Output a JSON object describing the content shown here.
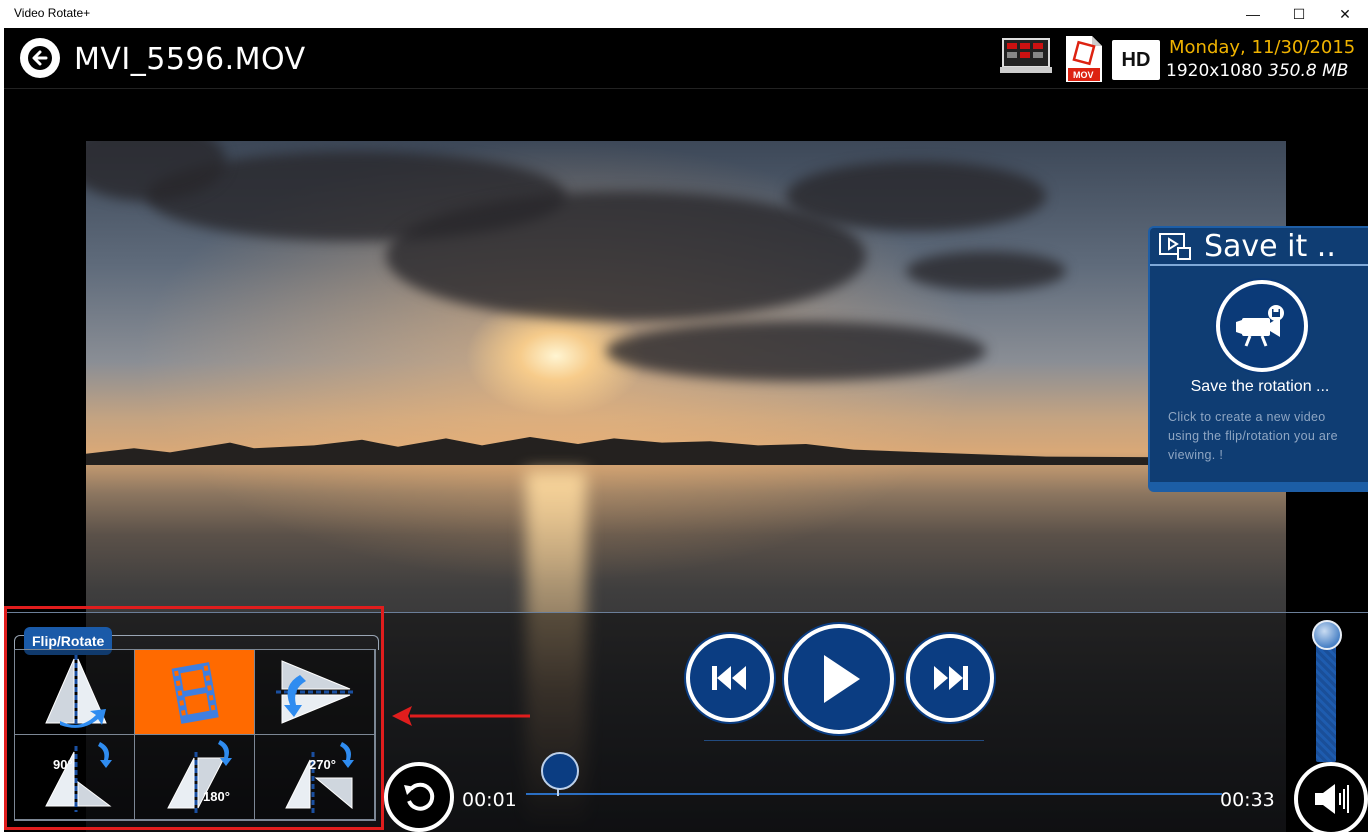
{
  "window": {
    "title": "Video Rotate+",
    "minimize": "—",
    "maximize": "☐",
    "close": "✕"
  },
  "header": {
    "file_name": "MVI_5596.MOV",
    "hd_badge": "HD",
    "date": "Monday, 11/30/2015",
    "resolution": "1920x1080",
    "file_size": "350.8 MB",
    "format_label": "MOV",
    "icons": [
      "back-arrow-icon",
      "display-icon",
      "mov-file-icon"
    ]
  },
  "save_panel": {
    "title": "Save it ..",
    "button_label": "Save the rotation ...",
    "description": "Click to create a new video using the flip/rotation you are viewing. !",
    "icons": [
      "save-panel-icon",
      "video-camera-save-icon"
    ]
  },
  "flip_rotate": {
    "tab_label": "Flip/Rotate",
    "selected_index": 1,
    "options": [
      {
        "id": "flip-horizontal",
        "icon": "flip-horizontal-icon"
      },
      {
        "id": "original",
        "icon": "film-strip-icon"
      },
      {
        "id": "flip-vertical",
        "icon": "flip-vertical-icon"
      },
      {
        "id": "rotate-90",
        "icon": "rotate-90-icon",
        "label": "90°"
      },
      {
        "id": "rotate-180",
        "icon": "rotate-180-icon",
        "label": "180°"
      },
      {
        "id": "rotate-270",
        "icon": "rotate-270-icon",
        "label": "270°"
      }
    ]
  },
  "player": {
    "current_time": "00:01",
    "total_time": "00:33",
    "progress_fraction": 0.03,
    "volume_fraction": 1.0,
    "icons": [
      "previous-icon",
      "play-icon",
      "next-icon",
      "replay-icon",
      "volume-icon"
    ]
  },
  "colors": {
    "accent_blue": "#0b3d82",
    "selected_orange": "#ff6a00",
    "date_color": "#f0b300",
    "highlight_red": "#e01d1d"
  }
}
